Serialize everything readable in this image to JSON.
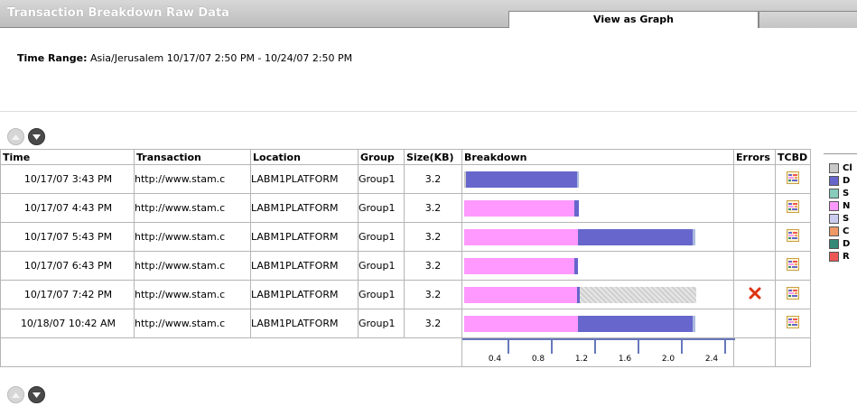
{
  "header": {
    "title": "Transaction Breakdown Raw Data",
    "tab_label": "View as Graph"
  },
  "time_range": {
    "label": "Time Range:",
    "value": "Asia/Jerusalem 10/17/07 2:50 PM - 10/24/07 2:50 PM"
  },
  "columns": [
    "Time",
    "Transaction",
    "Location",
    "Group",
    "Size(KB)",
    "Breakdown",
    "Errors",
    "TCBD"
  ],
  "rows": [
    {
      "time": "10/17/07 3:43 PM",
      "transaction": "http://www.stam.c",
      "location": "LABM1PLATFORM",
      "group": "Group1",
      "size": "3.2",
      "error": false,
      "segments": [
        {
          "color": "#c8c8c8",
          "value": 0.02
        },
        {
          "color": "#6666cc",
          "value": 1.02
        },
        {
          "color": "#aabbdd",
          "value": 0.02
        }
      ]
    },
    {
      "time": "10/17/07 4:43 PM",
      "transaction": "http://www.stam.c",
      "location": "LABM1PLATFORM",
      "group": "Group1",
      "size": "3.2",
      "error": false,
      "segments": [
        {
          "color": "#ff99ff",
          "value": 1.02
        },
        {
          "color": "#6666cc",
          "value": 0.04
        }
      ]
    },
    {
      "time": "10/17/07 5:43 PM",
      "transaction": "http://www.stam.c",
      "location": "LABM1PLATFORM",
      "group": "Group1",
      "size": "3.2",
      "error": false,
      "segments": [
        {
          "color": "#ff99ff",
          "value": 1.05
        },
        {
          "color": "#6666cc",
          "value": 1.06
        },
        {
          "color": "#aabbdd",
          "value": 0.02
        }
      ]
    },
    {
      "time": "10/17/07 6:43 PM",
      "transaction": "http://www.stam.c",
      "location": "LABM1PLATFORM",
      "group": "Group1",
      "size": "3.2",
      "error": false,
      "segments": [
        {
          "color": "#ff99ff",
          "value": 1.02
        },
        {
          "color": "#6666cc",
          "value": 0.03
        }
      ]
    },
    {
      "time": "10/17/07 7:42 PM",
      "transaction": "http://www.stam.c",
      "location": "LABM1PLATFORM",
      "group": "Group1",
      "size": "3.2",
      "error": true,
      "segments": [
        {
          "color": "#ff99ff",
          "value": 1.04
        },
        {
          "color": "#6666cc",
          "value": 0.03
        },
        {
          "color": "#d8d8d8",
          "value": 1.07
        }
      ]
    },
    {
      "time": "10/18/07 10:42 AM",
      "transaction": "http://www.stam.c",
      "location": "LABM1PLATFORM",
      "group": "Group1",
      "size": "3.2",
      "error": false,
      "segments": [
        {
          "color": "#ff99ff",
          "value": 1.05
        },
        {
          "color": "#6666cc",
          "value": 1.06
        },
        {
          "color": "#aabbdd",
          "value": 0.02
        }
      ]
    }
  ],
  "scale": {
    "max": 2.5,
    "ticks": [
      {
        "value": 0.4,
        "label": "0.4"
      },
      {
        "value": 0.8,
        "label": "0.8"
      },
      {
        "value": 1.2,
        "label": "1.2"
      },
      {
        "value": 1.6,
        "label": "1.6"
      },
      {
        "value": 2.0,
        "label": "2.0"
      },
      {
        "value": 2.4,
        "label": "2.4"
      }
    ]
  },
  "legend": [
    {
      "color": "#c8c8c8",
      "label": "Cl"
    },
    {
      "color": "#6666cc",
      "label": "D"
    },
    {
      "color": "#88ccbb",
      "label": "S"
    },
    {
      "color": "#ff99ff",
      "label": "N"
    },
    {
      "color": "#ccccee",
      "label": "S"
    },
    {
      "color": "#ee9966",
      "label": "C"
    },
    {
      "color": "#338877",
      "label": "D"
    },
    {
      "color": "#ee5555",
      "label": "R"
    }
  ],
  "icons": {
    "nav_up": "collapse-up-icon",
    "nav_down": "expand-down-icon",
    "error": "error-x-icon",
    "tcbd": "tcbd-report-icon"
  }
}
